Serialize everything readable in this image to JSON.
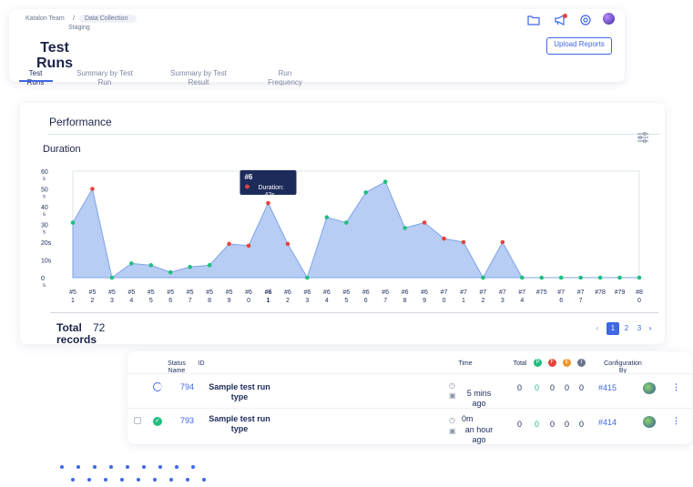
{
  "header": {
    "breadcrumb_team": "Katalon Team",
    "breadcrumb_sep": "/",
    "breadcrumb_project": "Data Collection",
    "breadcrumb_sub": "Staging",
    "page_title": "Test Runs",
    "upload_label": "Upload Reports",
    "tabs": [
      {
        "label": "Test Runs"
      },
      {
        "label": "Summary by Test Run"
      },
      {
        "label": "Summary by Test Result"
      },
      {
        "label": "Run Frequency"
      }
    ],
    "icons": [
      "folder-icon",
      "megaphone-icon",
      "settings-icon",
      "avatar"
    ]
  },
  "chart_section": {
    "title": "Performance",
    "subtitle": "Duration",
    "tooltip_title": "#6",
    "tooltip_text": "Duration: 42s"
  },
  "chart_data": {
    "type": "area",
    "ylabel": "",
    "ylim": [
      0,
      60
    ],
    "yticks": [
      "60 s",
      "50 s",
      "40 s",
      "30 s",
      "20s",
      "10s",
      "0 s"
    ],
    "categories": [
      "#51",
      "#52",
      "#53",
      "#54",
      "#55",
      "#56",
      "#57",
      "#58",
      "#59",
      "#60",
      "#61",
      "#62",
      "#63",
      "#64",
      "#65",
      "#66",
      "#67",
      "#68",
      "#69",
      "#70",
      "#71",
      "#72",
      "#73",
      "#74",
      "#75",
      "#76",
      "#77",
      "#78",
      "#79",
      "#80"
    ],
    "values": [
      31,
      50,
      0,
      8,
      7,
      3,
      6,
      7,
      19,
      18,
      42,
      19,
      0,
      34,
      31,
      48,
      54,
      28,
      31,
      22,
      20,
      0,
      20,
      0,
      0,
      0,
      0,
      0,
      0,
      0
    ],
    "status": [
      "passed",
      "failed",
      "passed",
      "passed",
      "passed",
      "passed",
      "passed",
      "passed",
      "failed",
      "failed",
      "failed",
      "failed",
      "passed",
      "passed",
      "passed",
      "passed",
      "passed",
      "passed",
      "failed",
      "failed",
      "failed",
      "passed",
      "failed",
      "passed",
      "passed",
      "passed",
      "passed",
      "passed",
      "passed",
      "passed"
    ],
    "colors": {
      "area": "#b7cdf4",
      "line": "#7fa3e8",
      "passed": "#1fbf7f",
      "failed": "#e2453c"
    },
    "highlighted": "#61"
  },
  "footer": {
    "total_label": "Total records",
    "total_value": "72",
    "pages": [
      "1",
      "2",
      "3"
    ],
    "current_page": "1"
  },
  "table": {
    "columns": {
      "status": "Status",
      "id": "ID",
      "name": "Name",
      "time": "Time",
      "total": "Total",
      "configuration": "Configuration",
      "by": "By"
    },
    "badges": [
      "P",
      "F",
      "E",
      "I"
    ],
    "badge_colors": [
      "#1fbf7f",
      "#e2453c",
      "#f0942a",
      "#6a7590"
    ],
    "rows": [
      {
        "id": "794",
        "name": "Sample test run type",
        "time": "5 mins ago",
        "duration": "",
        "counts": [
          "0",
          "0",
          "0",
          "0",
          "0"
        ],
        "config": "#415"
      },
      {
        "id": "793",
        "name": "Sample test run type",
        "time": "an hour ago",
        "duration": "0m",
        "counts": [
          "0",
          "0",
          "0",
          "0",
          "0"
        ],
        "config": "#414"
      }
    ]
  }
}
